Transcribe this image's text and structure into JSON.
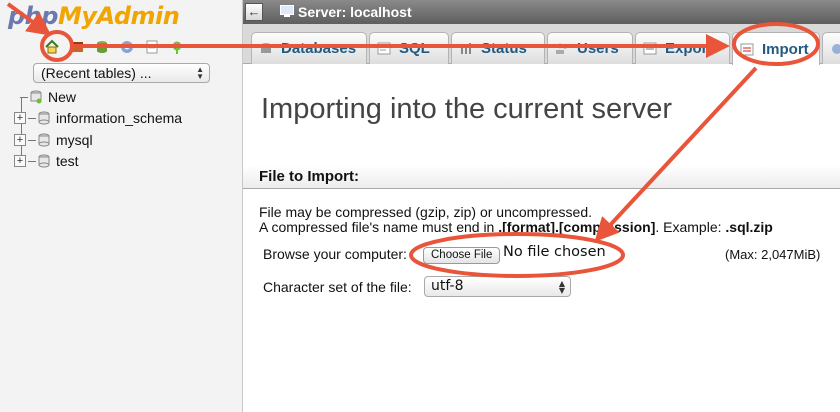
{
  "app": {
    "logo_php": "php",
    "logo_myadmin": "MyAdmin"
  },
  "nav": {
    "icons": [
      "home-icon",
      "table-icon",
      "db-icon",
      "gear-icon",
      "docs-icon",
      "settings-icon"
    ],
    "recent_tables": "(Recent tables) ...",
    "tree": [
      {
        "label": "New",
        "expandable": false
      },
      {
        "label": "information_schema",
        "expandable": true
      },
      {
        "label": "mysql",
        "expandable": true
      },
      {
        "label": "test",
        "expandable": true
      }
    ]
  },
  "server_bar": {
    "collapse_glyph": "←",
    "label": "Server: localhost"
  },
  "tabs": [
    {
      "label": "Databases",
      "icon": "databases-icon",
      "active": false
    },
    {
      "label": "SQL",
      "icon": "sql-icon",
      "active": false
    },
    {
      "label": "Status",
      "icon": "status-icon",
      "active": false
    },
    {
      "label": "Users",
      "icon": "users-icon",
      "active": false
    },
    {
      "label": "Export",
      "icon": "export-icon",
      "active": false
    },
    {
      "label": "Import",
      "icon": "import-icon",
      "active": true
    }
  ],
  "main": {
    "heading": "Importing into the current server",
    "section_title": "File to Import:",
    "note1": "File may be compressed (gzip, zip) or uncompressed.",
    "note2_prefix": "A compressed file's name must end in ",
    "note2_format": ".[format].[compression]",
    "note2_middle": ". Example: ",
    "note2_example": ".sql.zip",
    "browse_label": "Browse your computer:",
    "choose_file_button": "Choose File",
    "no_file_text": "No file chosen",
    "max_size": "(Max: 2,047MiB)",
    "charset_label": "Character set of the file:",
    "charset_value": "utf-8"
  },
  "colors": {
    "annotation": "#e8553a",
    "link": "#235a81",
    "logo_php": "#6c78af",
    "logo_myadmin": "#f0a500"
  }
}
